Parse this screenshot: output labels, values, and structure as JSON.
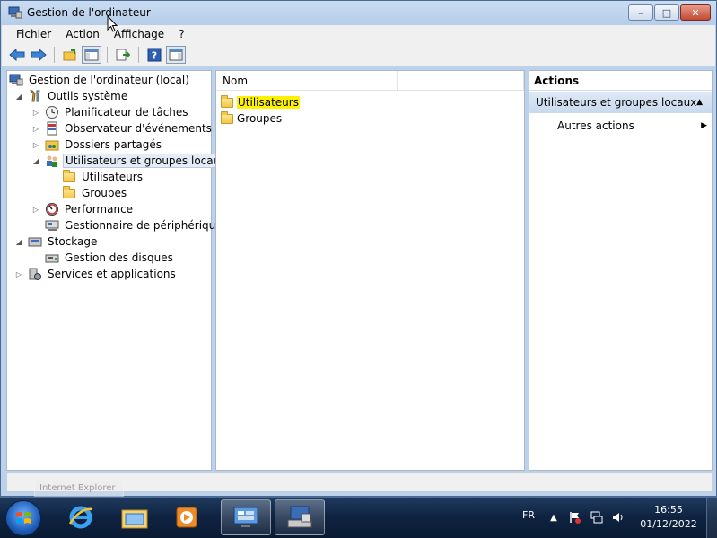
{
  "window": {
    "title": "Gestion de l'ordinateur",
    "buttons": {
      "minimize": "–",
      "maximize": "□",
      "close": "✕"
    }
  },
  "menu": [
    "Fichier",
    "Action",
    "Affichage",
    "?"
  ],
  "tree": [
    {
      "label": "Gestion de l'ordinateur (local)",
      "icon": "computer-management-icon",
      "expander": ""
    },
    {
      "label": "Outils système",
      "icon": "tools-icon",
      "expander": "◢"
    },
    {
      "label": "Planificateur de tâches",
      "icon": "clock-icon",
      "expander": "▷"
    },
    {
      "label": "Observateur d'événements",
      "icon": "event-viewer-icon",
      "expander": "▷"
    },
    {
      "label": "Dossiers partagés",
      "icon": "shared-folder-icon",
      "expander": "▷"
    },
    {
      "label": "Utilisateurs et groupes locaux",
      "icon": "users-icon",
      "expander": "◢"
    },
    {
      "label": "Utilisateurs",
      "icon": "folder-icon",
      "expander": ""
    },
    {
      "label": "Groupes",
      "icon": "folder-icon",
      "expander": ""
    },
    {
      "label": "Performance",
      "icon": "performance-icon",
      "expander": "▷"
    },
    {
      "label": "Gestionnaire de périphériques",
      "icon": "device-manager-icon",
      "expander": ""
    },
    {
      "label": "Stockage",
      "icon": "storage-icon",
      "expander": "◢"
    },
    {
      "label": "Gestion des disques",
      "icon": "disk-icon",
      "expander": ""
    },
    {
      "label": "Services et applications",
      "icon": "services-icon",
      "expander": "▷"
    }
  ],
  "list": {
    "column_header": "Nom",
    "items": [
      "Utilisateurs",
      "Groupes"
    ]
  },
  "actions": {
    "title": "Actions",
    "group": "Utilisateurs et groupes locaux",
    "group_arrow": "▲",
    "item": "Autres actions",
    "item_arrow": "▶"
  },
  "taskbar": {
    "tooltip": "Internet Explorer",
    "language": "FR",
    "time": "16:55",
    "date": "01/12/2022"
  },
  "colors": {
    "highlight": "#fff200",
    "selection": "#e5ecf6"
  }
}
